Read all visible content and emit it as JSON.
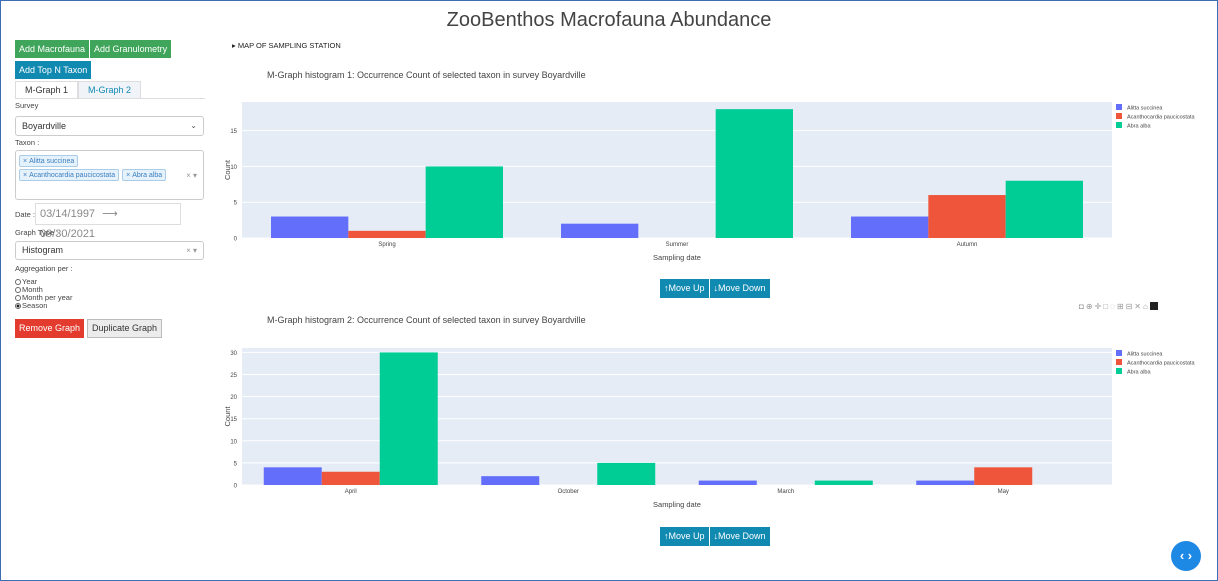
{
  "app": {
    "title": "ZooBenthos Macrofauna Abundance"
  },
  "sidebar": {
    "add_macrofauna": "Add Macrofauna",
    "add_granulometry": "Add Granulometry",
    "add_top_n_taxon": "Add Top N Taxon",
    "tabs": [
      "M-Graph 1",
      "M-Graph 2"
    ],
    "survey_label": "Survey",
    "survey_value": "Boyardville",
    "taxon_label": "Taxon :",
    "taxon_chips": [
      "Alitta succinea",
      "Acanthocardia paucicostata",
      "Abra alba"
    ],
    "date_label": "Date :",
    "date_start": "03/14/1997",
    "date_arrow": "⟶",
    "date_end": "09/30/2021",
    "graph_type_label": "Graph Type :",
    "graph_type_value": "Histogram",
    "aggregation_label": "Aggregation per :",
    "aggregation_options": [
      "Year",
      "Month",
      "Month per year",
      "Season"
    ],
    "aggregation_selected": "Season",
    "remove_graph": "Remove Graph",
    "duplicate_graph": "Duplicate Graph"
  },
  "main": {
    "map_toggle": "▸ MAP OF SAMPLING STATION",
    "move_up": "↑Move Up",
    "move_down": "↓Move Down",
    "toolbar_icons": "camera zoom pan box-select lasso zoom-in zoom-out autoscale reset logo"
  },
  "colors": {
    "series1": "#636efa",
    "series2": "#ef553b",
    "series3": "#00cc96",
    "teal": "#118ab2",
    "green": "#3fa55a",
    "red": "#e33c2e"
  },
  "chart_data": [
    {
      "type": "bar",
      "title": "M-Graph histogram 1: Occurrence Count of selected taxon in survey Boyardville",
      "xlabel": "Sampling date",
      "ylabel": "Count",
      "categories": [
        "Spring",
        "Summer",
        "Autumn"
      ],
      "ylim": [
        0,
        19
      ],
      "yticks": [
        0,
        5,
        10,
        15
      ],
      "legend": "top-right",
      "series": [
        {
          "name": "Alitta succinea",
          "values": [
            3,
            2,
            3
          ]
        },
        {
          "name": "Acanthocardia paucicostata",
          "values": [
            1,
            0,
            6
          ]
        },
        {
          "name": "Abra alba",
          "values": [
            10,
            18,
            8
          ]
        }
      ]
    },
    {
      "type": "bar",
      "title": "M-Graph histogram 2: Occurrence Count of selected taxon in survey Boyardville",
      "xlabel": "Sampling date",
      "ylabel": "Count",
      "categories": [
        "April",
        "October",
        "March",
        "May"
      ],
      "ylim": [
        0,
        31
      ],
      "yticks": [
        0,
        5,
        10,
        15,
        20,
        25,
        30
      ],
      "legend": "top-right",
      "series": [
        {
          "name": "Alitta succinea",
          "values": [
            4,
            2,
            1,
            1
          ]
        },
        {
          "name": "Acanthocardia paucicostata",
          "values": [
            3,
            0,
            0,
            4
          ]
        },
        {
          "name": "Abra alba",
          "values": [
            30,
            5,
            1,
            0
          ]
        }
      ]
    }
  ]
}
